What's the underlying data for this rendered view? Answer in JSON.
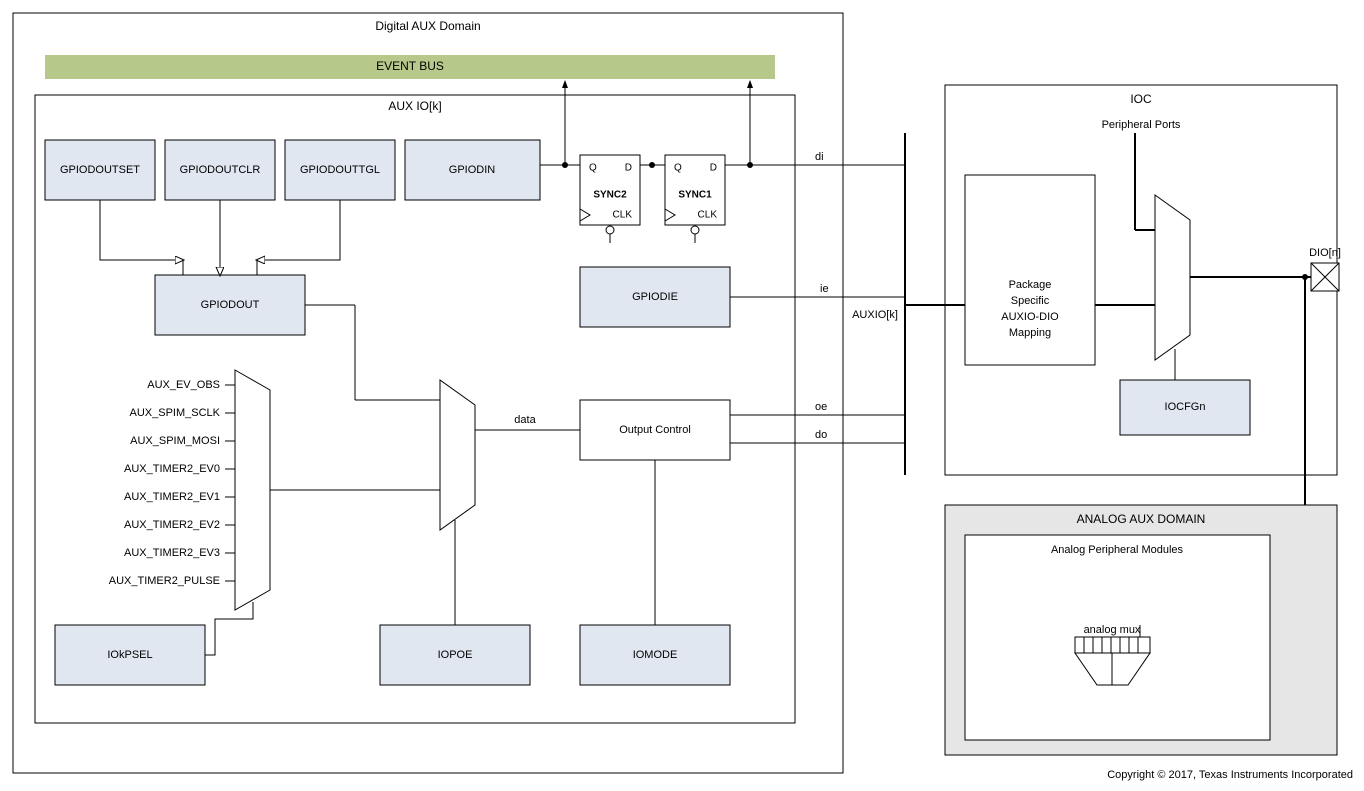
{
  "domain": {
    "digital": "Digital AUX Domain",
    "aux_io": "AUX IO[k]",
    "ioc": "IOC",
    "analog": "ANALOG AUX DOMAIN",
    "analog_modules": "Analog Peripheral Modules"
  },
  "bus": {
    "event": "EVENT BUS"
  },
  "blocks": {
    "gpiodoutset": "GPIODOUTSET",
    "gpiodoutclr": "GPIODOUTCLR",
    "gpiodouttgl": "GPIODOUTTGL",
    "gpiodin": "GPIODIN",
    "gpiodout": "GPIODOUT",
    "gpiodie": "GPIODIE",
    "iokpsel": "IOkPSEL",
    "iopoe": "IOPOE",
    "iomode": "IOMODE",
    "output_control": "Output Control",
    "iocfgn": "IOCFGn",
    "mapping1": "Package",
    "mapping2": "Specific",
    "mapping3": "AUXIO-DIO",
    "mapping4": "Mapping",
    "peripheral_ports": "Peripheral Ports",
    "analog_mux": "analog mux",
    "sync1": "SYNC1",
    "sync2": "SYNC2",
    "ff_q": "Q",
    "ff_d": "D",
    "ff_clk": "CLK"
  },
  "signals": {
    "di": "di",
    "ie": "ie",
    "oe": "oe",
    "do": "do",
    "data": "data",
    "auxio": "AUXIO[k]",
    "dio": "DIO[n]"
  },
  "mux_inputs": {
    "i0": "AUX_EV_OBS",
    "i1": "AUX_SPIM_SCLK",
    "i2": "AUX_SPIM_MOSI",
    "i3": "AUX_TIMER2_EV0",
    "i4": "AUX_TIMER2_EV1",
    "i5": "AUX_TIMER2_EV2",
    "i6": "AUX_TIMER2_EV3",
    "i7": "AUX_TIMER2_PULSE"
  },
  "footer": "Copyright © 2017, Texas Instruments Incorporated"
}
